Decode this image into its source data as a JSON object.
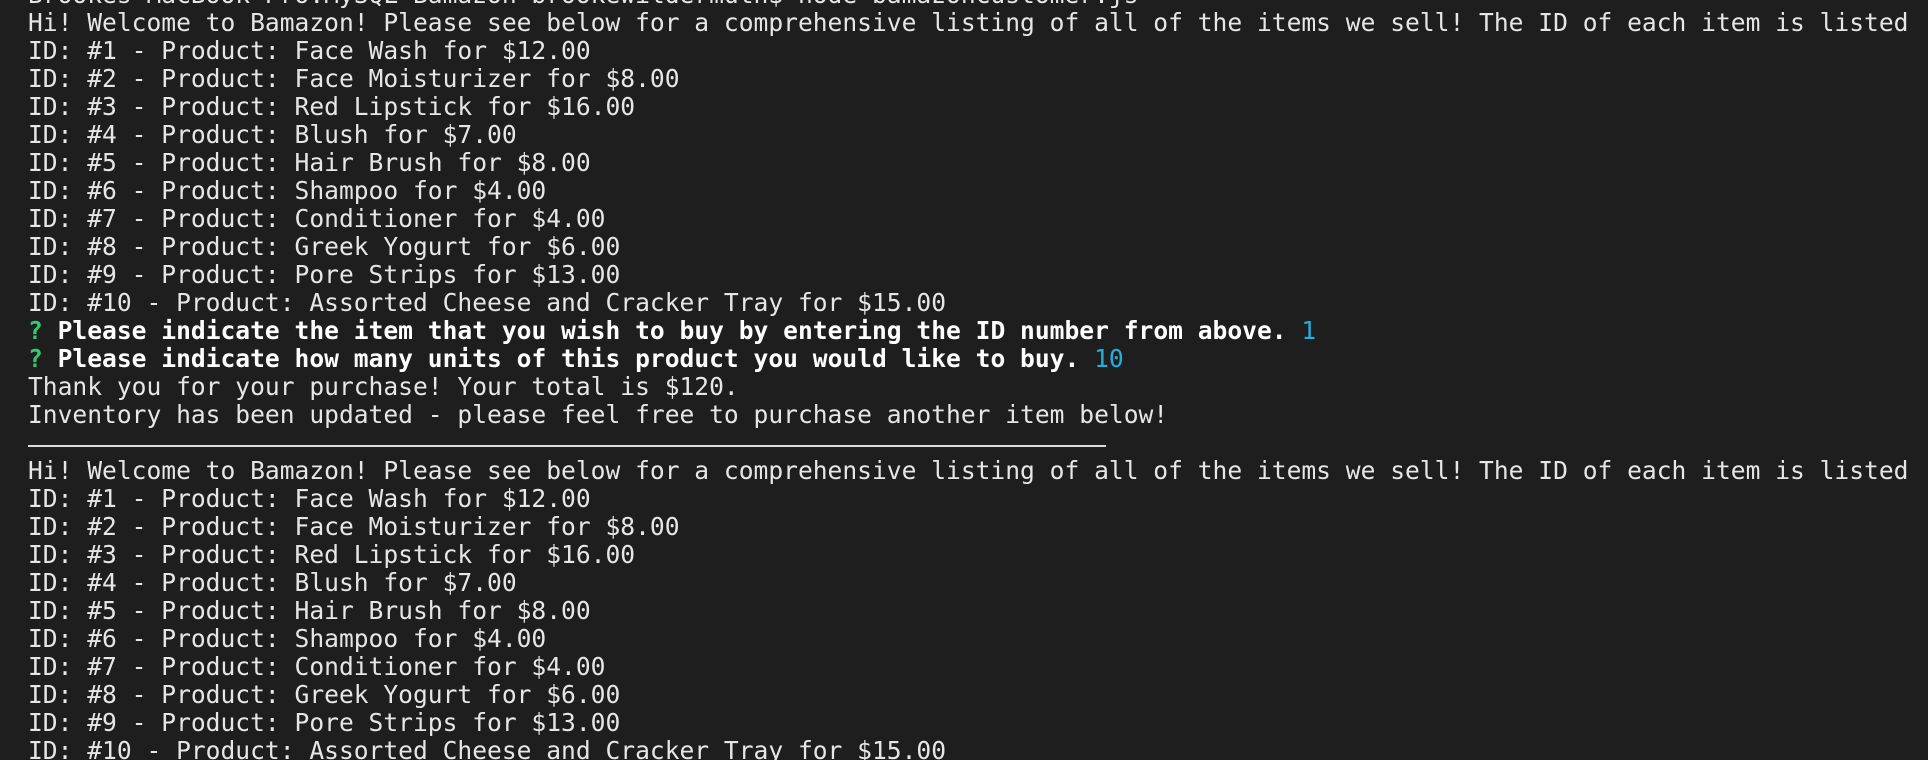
{
  "terminal": {
    "command_line": "Brookes-MacBook-Pro:MySQL-Bamazon brookewildermuth$ node bamazonCustomer.js",
    "colors": {
      "background": "#1e1e1e",
      "text": "#e6e6e6",
      "prompt_mark": "#2ecc71",
      "answer": "#1fb0e0"
    },
    "listing_1": {
      "welcome": "Hi! Welcome to Bamazon! Please see below for a comprehensive listing of all of the items we sell! The ID of each item is listed first.",
      "items": [
        "ID: #1 - Product: Face Wash for $12.00",
        "ID: #2 - Product: Face Moisturizer for $8.00",
        "ID: #3 - Product: Red Lipstick for $16.00",
        "ID: #4 - Product: Blush for $7.00",
        "ID: #5 - Product: Hair Brush for $8.00",
        "ID: #6 - Product: Shampoo for $4.00",
        "ID: #7 - Product: Conditioner for $4.00",
        "ID: #8 - Product: Greek Yogurt for $6.00",
        "ID: #9 - Product: Pore Strips for $13.00",
        "ID: #10 - Product: Assorted Cheese and Cracker Tray for $15.00"
      ]
    },
    "question_1": {
      "mark": "?",
      "text": "Please indicate the item that you wish to buy by entering the ID number from above.",
      "answer": "1"
    },
    "question_2": {
      "mark": "?",
      "text": "Please indicate how many units of this product you would like to buy.",
      "answer": "10"
    },
    "thank_you": "Thank you for your purchase! Your total is $120.",
    "inventory_msg": "Inventory has been updated - please feel free to purchase another item below!",
    "listing_2": {
      "welcome": "Hi! Welcome to Bamazon! Please see below for a comprehensive listing of all of the items we sell! The ID of each item is listed first.",
      "items": [
        "ID: #1 - Product: Face Wash for $12.00",
        "ID: #2 - Product: Face Moisturizer for $8.00",
        "ID: #3 - Product: Red Lipstick for $16.00",
        "ID: #4 - Product: Blush for $7.00",
        "ID: #5 - Product: Hair Brush for $8.00",
        "ID: #6 - Product: Shampoo for $4.00",
        "ID: #7 - Product: Conditioner for $4.00",
        "ID: #8 - Product: Greek Yogurt for $6.00",
        "ID: #9 - Product: Pore Strips for $13.00",
        "ID: #10 - Product: Assorted Cheese and Cracker Tray for $15.00"
      ]
    }
  }
}
